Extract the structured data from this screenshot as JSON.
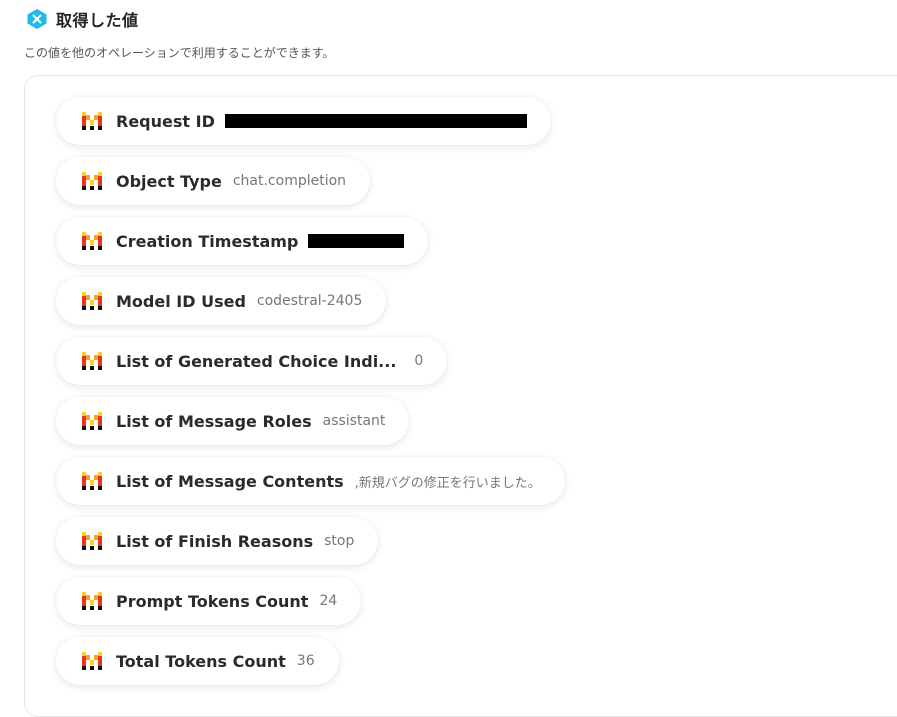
{
  "header": {
    "title": "取得した値",
    "subtitle": "この値を他のオペレーションで利用することができます。",
    "icon": "x-badge-icon",
    "accent": "#22b8e8"
  },
  "items": [
    {
      "label": "Request ID",
      "value": "",
      "redacted": true
    },
    {
      "label": "Object Type",
      "value": "chat.completion",
      "redacted": false
    },
    {
      "label": "Creation Timestamp",
      "value": "",
      "redacted": true
    },
    {
      "label": "Model ID Used",
      "value": "codestral-2405",
      "redacted": false
    },
    {
      "label": "List of Generated Choice Indi...",
      "value": "0",
      "redacted": false
    },
    {
      "label": "List of Message Roles",
      "value": "assistant",
      "redacted": false
    },
    {
      "label": "List of Message Contents",
      "value": ",新規バグの修正を行いました。",
      "redacted": false
    },
    {
      "label": "List of Finish Reasons",
      "value": "stop",
      "redacted": false
    },
    {
      "label": "Prompt Tokens Count",
      "value": "24",
      "redacted": false
    },
    {
      "label": "Total Tokens Count",
      "value": "36",
      "redacted": false
    }
  ],
  "icon_name": "mistral-m-icon"
}
